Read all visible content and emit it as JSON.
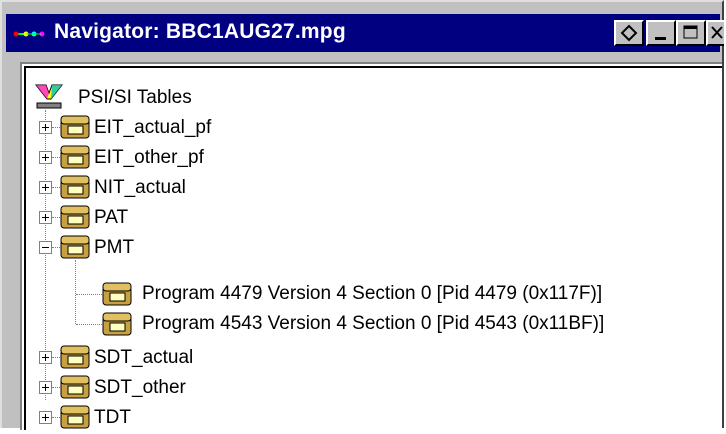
{
  "window": {
    "title": "Navigator: BBC1AUG27.mpg",
    "colors": {
      "titlebar": "#000080",
      "face": "#c0c0c0"
    }
  },
  "tree": {
    "root": {
      "label": "PSI/SI Tables",
      "icon": "psi-si-root-icon"
    },
    "items": [
      {
        "label": "EIT_actual_pf",
        "expanded": false
      },
      {
        "label": "EIT_other_pf",
        "expanded": false
      },
      {
        "label": "NIT_actual",
        "expanded": false
      },
      {
        "label": "PAT",
        "expanded": false
      },
      {
        "label": "PMT",
        "expanded": true,
        "children": [
          {
            "label": "Program 4479 Version 4 Section 0 [Pid 4479 (0x117F)]"
          },
          {
            "label": "Program 4543 Version 4 Section 0 [Pid 4543 (0x11BF)]"
          }
        ]
      },
      {
        "label": "SDT_actual",
        "expanded": false
      },
      {
        "label": "SDT_other",
        "expanded": false
      },
      {
        "label": "TDT",
        "expanded": false
      }
    ]
  }
}
